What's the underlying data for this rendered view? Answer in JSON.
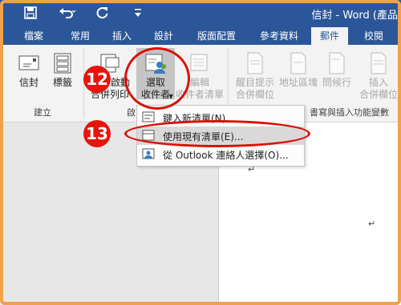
{
  "window": {
    "title": "信封 - Word (產品"
  },
  "quick_access": {
    "save_icon": "save-icon",
    "undo_icon": "undo-icon",
    "redo_icon": "redo-icon",
    "customize_icon": "customize-qat-icon"
  },
  "tabs": [
    {
      "label": "檔案"
    },
    {
      "label": "常用"
    },
    {
      "label": "插入"
    },
    {
      "label": "設計"
    },
    {
      "label": "版面配置"
    },
    {
      "label": "參考資料"
    },
    {
      "label": "郵件",
      "active": true
    },
    {
      "label": "校閱"
    }
  ],
  "ribbon": {
    "create_group": {
      "label": "建立",
      "envelopes": "信封",
      "labels": "標籤"
    },
    "start_merge": {
      "line1": "啟動",
      "line2": "合併列印",
      "label": "啟"
    },
    "select_recipients": {
      "line1": "選取",
      "line2": "收件者"
    },
    "edit_recipients": {
      "line1": "編輯",
      "line2": "收件者清單"
    },
    "write_insert_group": {
      "label": "書寫與插入功能變數",
      "highlight_fields": {
        "line1": "醒目提示",
        "line2": "合併欄位"
      },
      "address_block": "地址區塊",
      "greeting_line": "問候行",
      "insert_field": {
        "line1": "插入",
        "line2": "合併欄位"
      }
    }
  },
  "menu": {
    "items": [
      {
        "label": "鍵入新清單(N)..."
      },
      {
        "label": "使用現有清單(E)..."
      },
      {
        "label": "從 Outlook 連絡人選擇(O)..."
      }
    ]
  },
  "annotations": {
    "step12": "12",
    "step13": "13",
    "colors": {
      "accent": "#e8140c",
      "ribbon_blue": "#2b579a"
    }
  }
}
